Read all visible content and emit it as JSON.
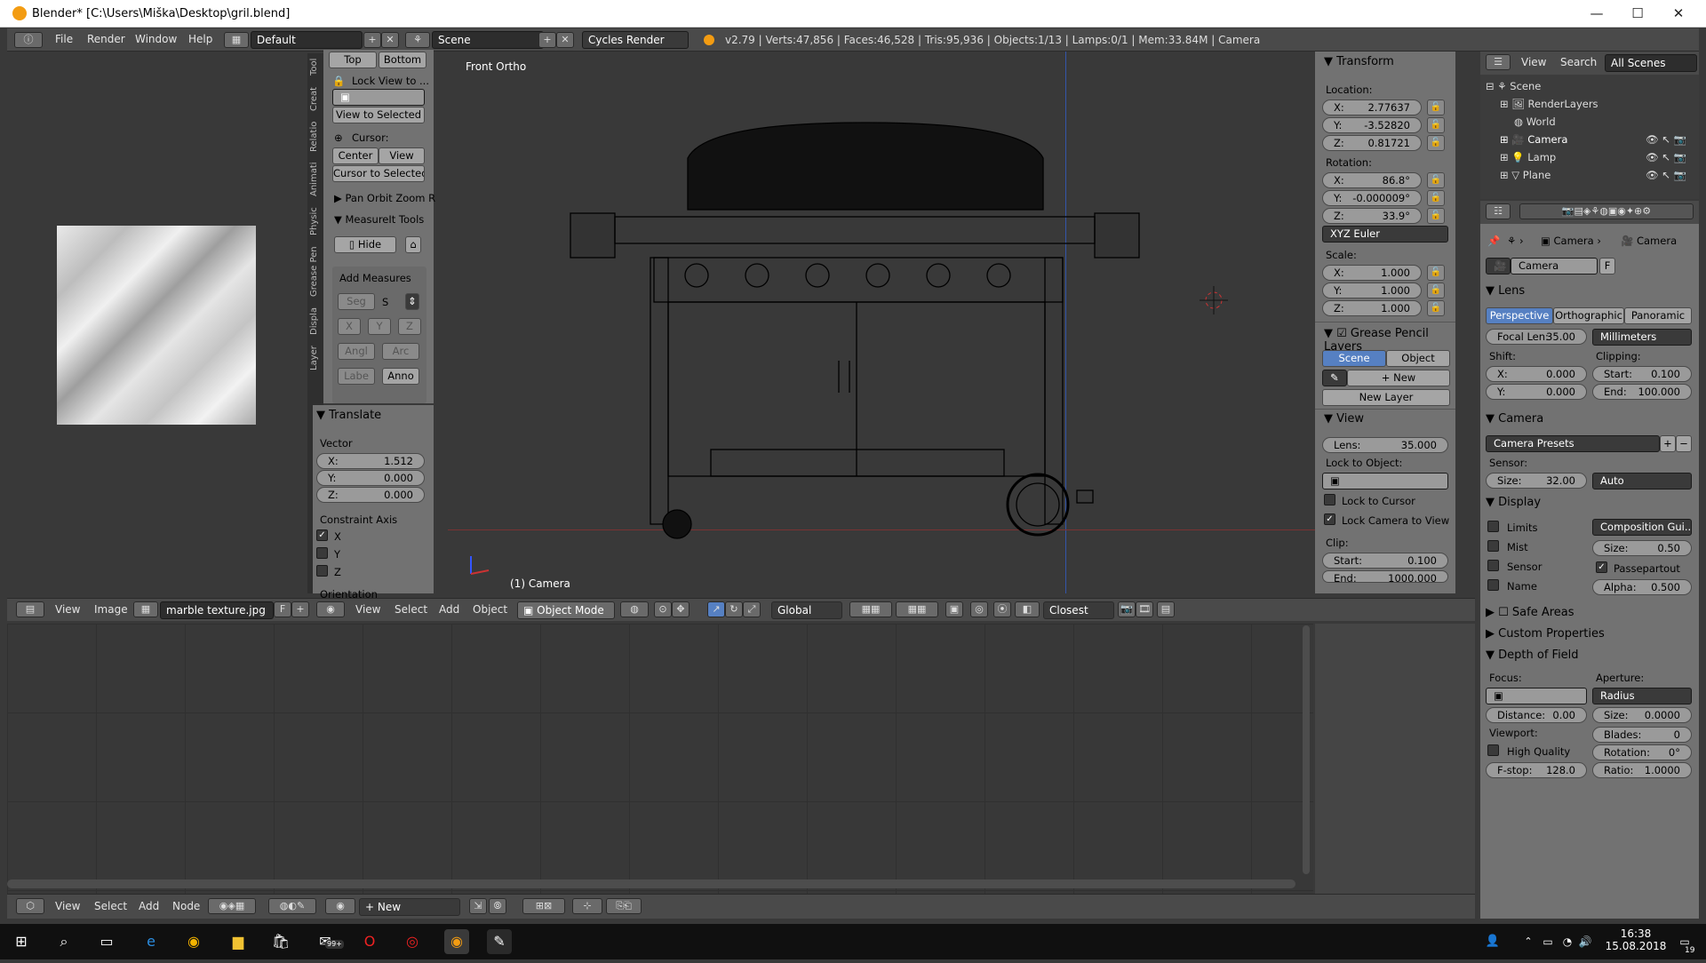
{
  "window": {
    "title": "Blender* [C:\\Users\\Miška\\Desktop\\gril.blend]",
    "minimize": "—",
    "maximize": "☐",
    "close": "✕"
  },
  "menu": {
    "file": "File",
    "render": "Render",
    "window": "Window",
    "help": "Help",
    "layout": "Default",
    "scene": "Scene",
    "engine": "Cycles Render",
    "stats": "v2.79 | Verts:47,856 | Faces:46,528 | Tris:95,936 | Objects:1/13 | Lamps:0/1 | Mem:33.84M | Camera"
  },
  "image_editor": {
    "menu_view": "View",
    "menu_image": "Image",
    "image_name": "marble texture.jpg",
    "fake_user": "F"
  },
  "toolshelf": {
    "tabs": [
      "Tool",
      "Creat",
      "Relatio",
      "Animati",
      "Physic",
      "Grease Pen",
      "Displa",
      "Layer"
    ],
    "top": "Top",
    "bottom": "Bottom",
    "lock_view": "Lock View to ...",
    "view_to_selected": "View to Selected",
    "cursor_label": "Cursor:",
    "center": "Center",
    "view": "View",
    "cursor_to_selected": "Cursor to Selected",
    "pan_orbit": "Pan Orbit Zoom R",
    "measureit": "MeasureIt Tools",
    "hide": "Hide",
    "add_measures": "Add Measures",
    "seg": "Seg",
    "s": "S",
    "x": "X",
    "y": "Y",
    "z": "Z",
    "angl": "Angl",
    "arc": "Arc",
    "labe": "Labe",
    "anno": "Anno"
  },
  "translate": {
    "title": "Translate",
    "vector": "Vector",
    "x": "X:",
    "xv": "1.512",
    "y": "Y:",
    "yv": "0.000",
    "z": "Z:",
    "zv": "0.000",
    "constraint": "Constraint Axis",
    "cx": "X",
    "cy": "Y",
    "cz": "Z",
    "orientation": "Orientation"
  },
  "viewport": {
    "label": "Front Ortho",
    "object_label": "(1) Camera"
  },
  "view3d_header": {
    "view": "View",
    "select": "Select",
    "add": "Add",
    "object": "Object",
    "mode": "Object Mode",
    "orientation": "Global",
    "snap": "Closest"
  },
  "npanel": {
    "transform": "Transform",
    "location": "Location:",
    "lx": "X:",
    "lxv": "2.77637",
    "ly": "Y:",
    "lyv": "-3.52820",
    "lz": "Z:",
    "lzv": "0.81721",
    "rotation": "Rotation:",
    "rx": "X:",
    "rxv": "86.8°",
    "ry": "Y:",
    "ryv": "-0.000009°",
    "rz": "Z:",
    "rzv": "33.9°",
    "euler": "XYZ Euler",
    "scale": "Scale:",
    "sx": "X:",
    "sxv": "1.000",
    "sy": "Y:",
    "syv": "1.000",
    "sz": "Z:",
    "szv": "1.000",
    "gp_layers": "Grease Pencil Layers",
    "scene": "Scene",
    "object": "Object",
    "new": "New",
    "new_layer": "New Layer",
    "view": "View",
    "lens": "Lens:",
    "lensv": "35.000",
    "lock_to_object": "Lock to Object:",
    "lock_to_cursor": "Lock to Cursor",
    "lock_camera": "Lock Camera to View",
    "clip": "Clip:",
    "start": "Start:",
    "startv": "0.100",
    "end": "End:",
    "endv": "1000.000"
  },
  "outliner": {
    "view": "View",
    "search": "Search",
    "scenes": "All Scenes",
    "items": [
      "Scene",
      "RenderLayers",
      "World",
      "Camera",
      "Lamp",
      "Plane"
    ]
  },
  "properties": {
    "crumb1": "Camera",
    "crumb2": "Camera",
    "datablock": "Camera",
    "f": "F",
    "lens": "Lens",
    "perspective": "Perspective",
    "orthographic": "Orthographic",
    "panoramic": "Panoramic",
    "focal": "Focal Len:",
    "focalv": "35.00",
    "units": "Millimeters",
    "shift": "Shift:",
    "clipping": "Clipping:",
    "sx": "X:",
    "sxv": "0.000",
    "sy": "Y:",
    "syv": "0.000",
    "cstart": "Start:",
    "cstartv": "0.100",
    "cend": "End:",
    "cendv": "100.000",
    "camera": "Camera",
    "presets": "Camera Presets",
    "sensor": "Sensor:",
    "size": "Size:",
    "sizev": "32.00",
    "fit": "Auto",
    "display": "Display",
    "limits": "Limits",
    "mist": "Mist",
    "sensor_chk": "Sensor",
    "name": "Name",
    "composition": "Composition Gui...",
    "dsize": "Size:",
    "dsizev": "0.50",
    "passepartout": "Passepartout",
    "alpha": "Alpha:",
    "alphav": "0.500",
    "safe_areas": "Safe Areas",
    "custom_props": "Custom Properties",
    "dof": "Depth of Field",
    "focus": "Focus:",
    "aperture": "Aperture:",
    "radius": "Radius",
    "distance": "Distance:",
    "distancev": "0.00",
    "asize": "Size:",
    "asizev": "0.0000",
    "viewport": "Viewport:",
    "blades": "Blades:",
    "bladesv": "0",
    "high_quality": "High Quality",
    "rotation": "Rotation:",
    "rotationv": "0°",
    "fstop": "F-stop:",
    "fstopv": "128.0",
    "ratio": "Ratio:",
    "ratiov": "1.0000"
  },
  "node_header": {
    "view": "View",
    "select": "Select",
    "add": "Add",
    "node": "Node",
    "new": "New"
  },
  "taskbar": {
    "time": "16:38",
    "date": "15.08.2018",
    "badge": "99+",
    "notif": "19"
  }
}
